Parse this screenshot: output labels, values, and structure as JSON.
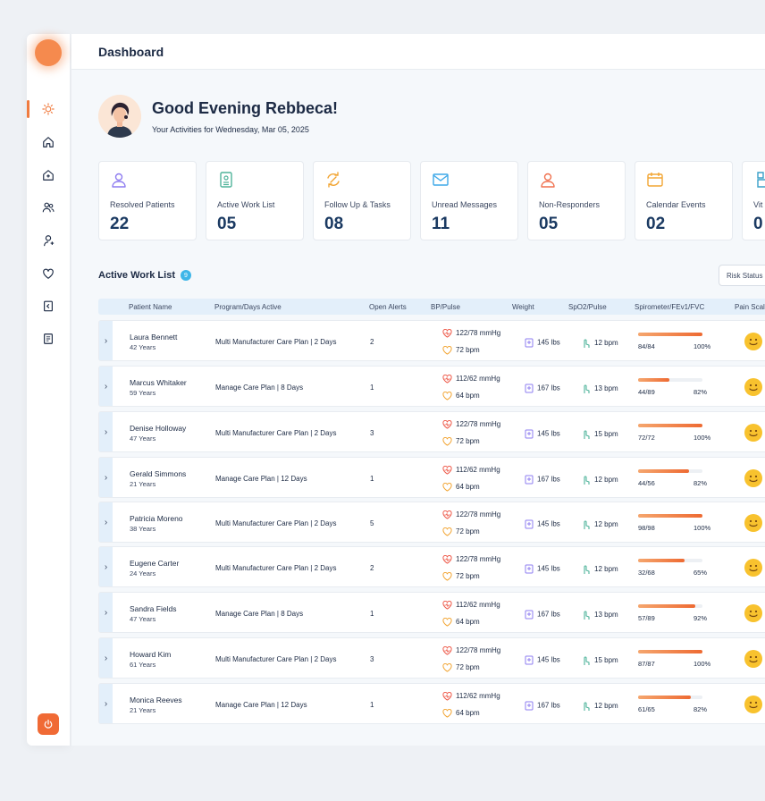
{
  "header": {
    "title": "Dashboard"
  },
  "greeting": {
    "title": "Good Evening Rebbeca!",
    "subtitle": "Your Activities for Wednesday, Mar 05, 2025"
  },
  "sidebar": {
    "items": [
      {
        "icon": "sun-icon",
        "active": true
      },
      {
        "icon": "home-icon"
      },
      {
        "icon": "medical-house-icon"
      },
      {
        "icon": "users-icon"
      },
      {
        "icon": "user-add-icon"
      },
      {
        "icon": "heart-icon"
      },
      {
        "icon": "clipboard-icon"
      },
      {
        "icon": "document-icon"
      }
    ]
  },
  "cards": [
    {
      "label": "Resolved Patients",
      "value": "22",
      "icon": "user-check-icon",
      "color": "#8e7cf0"
    },
    {
      "label": "Active Work List",
      "value": "05",
      "icon": "id-card-icon",
      "color": "#4fb39a"
    },
    {
      "label": "Follow Up & Tasks",
      "value": "08",
      "icon": "arrows-icon",
      "color": "#f2a533"
    },
    {
      "label": "Unread Messages",
      "value": "11",
      "icon": "envelope-icon",
      "color": "#3fa9e8"
    },
    {
      "label": "Non-Responders",
      "value": "05",
      "icon": "user-x-icon",
      "color": "#f0714f"
    },
    {
      "label": "Calendar Events",
      "value": "02",
      "icon": "calendar-icon",
      "color": "#f2a533"
    },
    {
      "label": "Vit",
      "value": "0",
      "icon": "vitals-icon",
      "color": "#3aa0c9"
    }
  ],
  "worklist": {
    "title": "Active Work List",
    "count": "9",
    "filter_label": "Risk Status :",
    "columns": [
      "Patient Name",
      "Program/Days Active",
      "Open Alerts",
      "BP/Pulse",
      "Weight",
      "SpO2/Pulse",
      "Spirometer/FEv1/FVC",
      "Pain Scale"
    ],
    "rows": [
      {
        "name": "Laura Bennett",
        "age": "42 Years",
        "program": "Multi Manufacturer Care Plan | 2 Days",
        "alerts": "2",
        "bp": "122/78 mmHg",
        "pulse": "72 bpm",
        "weight": "145 lbs",
        "spo2": "12 bpm",
        "spiro": "84/84",
        "spiro_pct": "100%",
        "fill": 1.0
      },
      {
        "name": "Marcus Whitaker",
        "age": "59 Years",
        "program": "Manage Care Plan | 8 Days",
        "alerts": "1",
        "bp": "112/62 mmHg",
        "pulse": "64 bpm",
        "weight": "167 lbs",
        "spo2": "13 bpm",
        "spiro": "44/89",
        "spiro_pct": "82%",
        "fill": 0.49
      },
      {
        "name": "Denise Holloway",
        "age": "47 Years",
        "program": "Multi Manufacturer Care Plan | 2 Days",
        "alerts": "3",
        "bp": "122/78 mmHg",
        "pulse": "72 bpm",
        "weight": "145 lbs",
        "spo2": "15 bpm",
        "spiro": "72/72",
        "spiro_pct": "100%",
        "fill": 1.0
      },
      {
        "name": "Gerald Simmons",
        "age": "21 Years",
        "program": "Manage Care Plan | 12 Days",
        "alerts": "1",
        "bp": "112/62 mmHg",
        "pulse": "64 bpm",
        "weight": "167 lbs",
        "spo2": "12 bpm",
        "spiro": "44/56",
        "spiro_pct": "82%",
        "fill": 0.79
      },
      {
        "name": "Patricia Moreno",
        "age": "38 Years",
        "program": "Multi Manufacturer Care Plan | 2 Days",
        "alerts": "5",
        "bp": "122/78 mmHg",
        "pulse": "72 bpm",
        "weight": "145 lbs",
        "spo2": "12 bpm",
        "spiro": "98/98",
        "spiro_pct": "100%",
        "fill": 1.0
      },
      {
        "name": "Eugene Carter",
        "age": "24 Years",
        "program": "Multi Manufacturer Care Plan | 2 Days",
        "alerts": "2",
        "bp": "122/78 mmHg",
        "pulse": "72 bpm",
        "weight": "145 lbs",
        "spo2": "12 bpm",
        "spiro": "32/68",
        "spiro_pct": "65%",
        "fill": 0.72
      },
      {
        "name": "Sandra Fields",
        "age": "47 Years",
        "program": "Manage Care Plan | 8 Days",
        "alerts": "1",
        "bp": "112/62 mmHg",
        "pulse": "64 bpm",
        "weight": "167 lbs",
        "spo2": "13 bpm",
        "spiro": "57/89",
        "spiro_pct": "92%",
        "fill": 0.89
      },
      {
        "name": "Howard Kim",
        "age": "61 Years",
        "program": "Multi Manufacturer Care Plan | 2 Days",
        "alerts": "3",
        "bp": "122/78 mmHg",
        "pulse": "72 bpm",
        "weight": "145 lbs",
        "spo2": "15 bpm",
        "spiro": "87/87",
        "spiro_pct": "100%",
        "fill": 1.0
      },
      {
        "name": "Monica Reeves",
        "age": "21 Years",
        "program": "Manage Care Plan | 12 Days",
        "alerts": "1",
        "bp": "112/62 mmHg",
        "pulse": "64 bpm",
        "weight": "167 lbs",
        "spo2": "12 bpm",
        "spiro": "61/65",
        "spiro_pct": "82%",
        "fill": 0.82
      }
    ]
  },
  "colors": {
    "accent": "#f07b3f",
    "heading": "#1b3a62",
    "table_header": "#e3effa"
  }
}
